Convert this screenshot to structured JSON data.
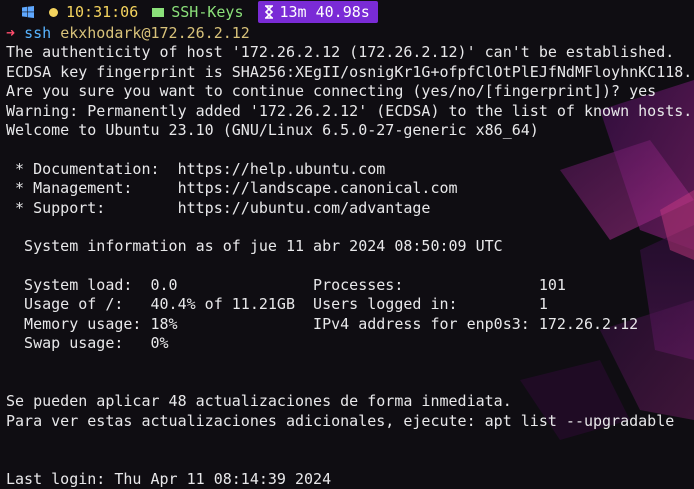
{
  "prompt": {
    "os_icon": "windows-icon",
    "time": "10:31:06",
    "folder_icon": "folder-icon",
    "directory": "SSH-Keys",
    "timer_icon": "hourglass-icon",
    "duration": "13m 40.98s"
  },
  "command": {
    "arrow": "➜",
    "name": "ssh",
    "argument": "ekxhodark@172.26.2.12"
  },
  "output": {
    "lines": [
      "The authenticity of host '172.26.2.12 (172.26.2.12)' can't be established.",
      "ECDSA key fingerprint is SHA256:XEgII/osnigKr1G+ofpfClOtPlEJfNdMFloyhnKC118.",
      "Are you sure you want to continue connecting (yes/no/[fingerprint])? yes",
      "Warning: Permanently added '172.26.2.12' (ECDSA) to the list of known hosts.",
      "Welcome to Ubuntu 23.10 (GNU/Linux 6.5.0-27-generic x86_64)",
      "",
      " * Documentation:  https://help.ubuntu.com",
      " * Management:     https://landscape.canonical.com",
      " * Support:        https://ubuntu.com/advantage",
      "",
      "  System information as of jue 11 abr 2024 08:50:09 UTC",
      "",
      "  System load:  0.0               Processes:               101",
      "  Usage of /:   40.4% of 11.21GB  Users logged in:         1",
      "  Memory usage: 18%               IPv4 address for enp0s3: 172.26.2.12",
      "  Swap usage:   0%",
      "",
      "",
      "Se pueden aplicar 48 actualizaciones de forma inmediata.",
      "Para ver estas actualizaciones adicionales, ejecute: apt list --upgradable",
      "",
      "",
      "Last login: Thu Apr 11 08:14:39 2024"
    ]
  },
  "colors": {
    "background": "#0f0d12",
    "text": "#e8e8ea",
    "accent_purple": "#7a2bd6",
    "arrow_red": "#ff4d6d",
    "command_blue": "#58b4ff"
  }
}
